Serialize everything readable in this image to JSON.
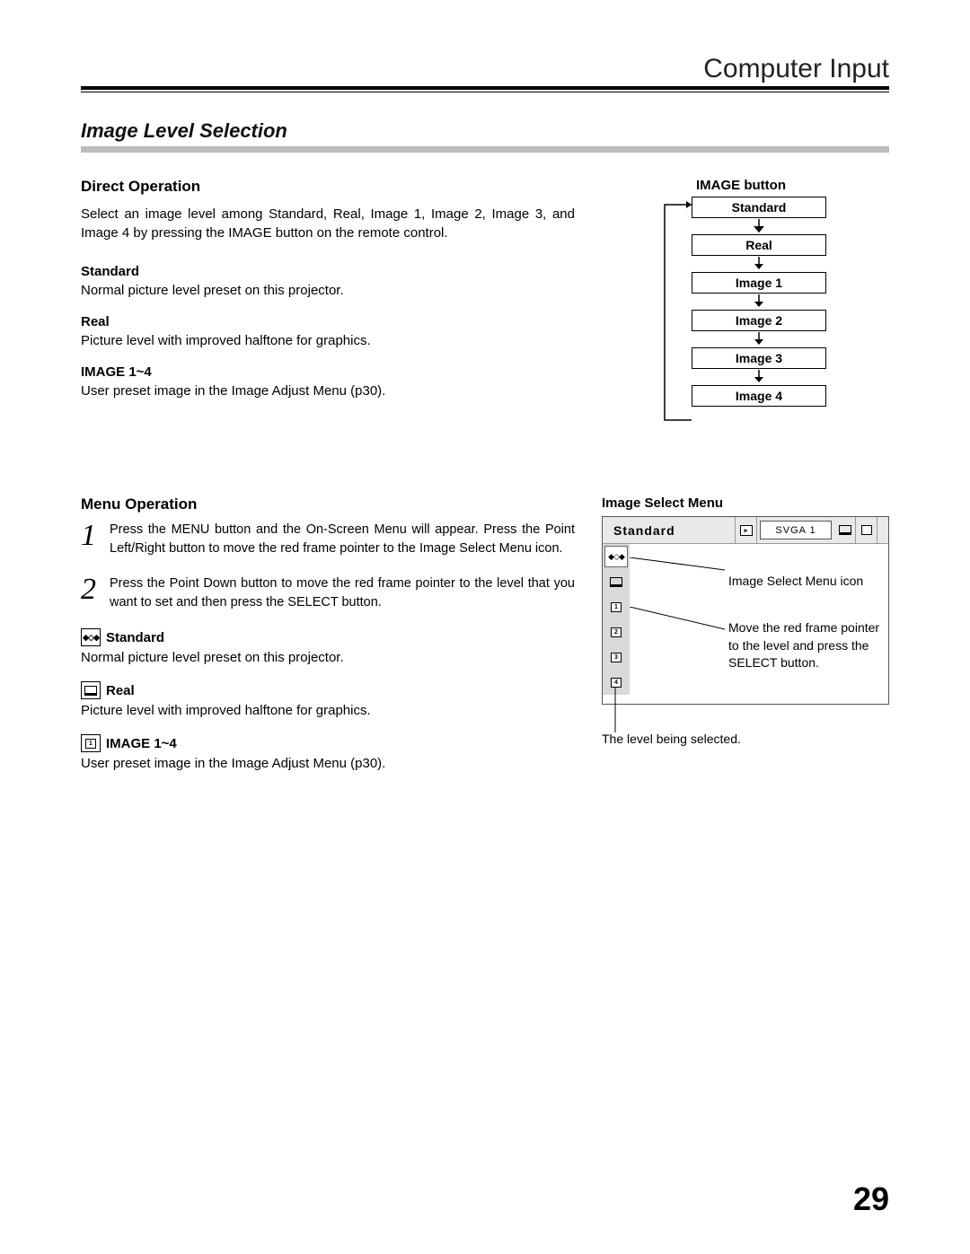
{
  "header": {
    "title": "Computer Input"
  },
  "section_title": "Image Level Selection",
  "direct_op": {
    "heading": "Direct Operation",
    "intro": "Select an image level among Standard, Real, Image 1, Image 2, Image 3, and Image 4 by pressing the IMAGE button on the remote control.",
    "items": [
      {
        "head": "Standard",
        "body": "Normal picture level preset on this projector."
      },
      {
        "head": "Real",
        "body": "Picture level with improved halftone for graphics."
      },
      {
        "head": "IMAGE 1~4",
        "body": "User preset image in the Image Adjust Menu (p30)."
      }
    ]
  },
  "flow": {
    "title": "IMAGE button",
    "boxes": [
      "Standard",
      "Real",
      "Image 1",
      "Image 2",
      "Image 3",
      "Image 4"
    ]
  },
  "menu_op": {
    "heading": "Menu Operation",
    "steps": [
      "Press the MENU button and the On-Screen Menu will appear. Press the Point Left/Right button to move the red frame pointer to the Image Select Menu icon.",
      "Press the Point Down button to move the red frame pointer to the level that you want to set and then press the SELECT button."
    ],
    "icon_items": [
      {
        "head": "Standard",
        "body": "Normal picture level preset on this projector."
      },
      {
        "head": "Real",
        "body": "Picture level with improved halftone for graphics."
      },
      {
        "head": "IMAGE 1~4",
        "body": "User preset image in the Image Adjust Menu (p30)."
      }
    ]
  },
  "osd": {
    "title": "Image Select Menu",
    "top_label": "Standard",
    "svga": "SVGA 1",
    "side_nums": [
      "1",
      "2",
      "3",
      "4"
    ],
    "callout1": "Image Select Menu icon",
    "callout2": "Move the red frame pointer to the level and press the SELECT button.",
    "caption": "The level being selected."
  },
  "page_number": "29"
}
